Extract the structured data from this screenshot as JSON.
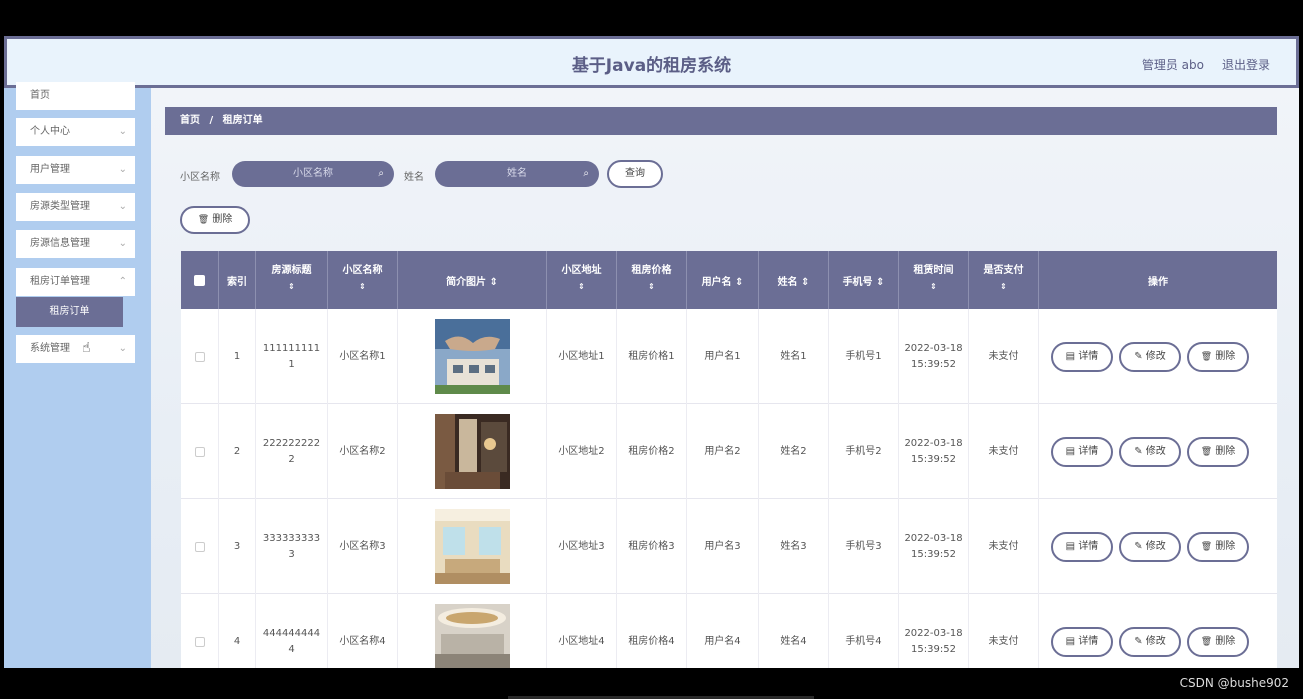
{
  "header": {
    "title": "基于Java的租房系统",
    "user": "管理员 abo",
    "logout": "退出登录"
  },
  "sidebar": {
    "items": [
      {
        "label": "首页",
        "chevron": ""
      },
      {
        "label": "个人中心",
        "chevron": "⌄"
      },
      {
        "label": "用户管理",
        "chevron": "⌄"
      },
      {
        "label": "房源类型管理",
        "chevron": "⌄"
      },
      {
        "label": "房源信息管理",
        "chevron": "⌄"
      },
      {
        "label": "租房订单管理",
        "chevron": "⌃"
      },
      {
        "label": "系统管理",
        "chevron": "⌄"
      }
    ],
    "submenu": {
      "label": "租房订单"
    }
  },
  "breadcrumb": {
    "home": "首页",
    "separator": "/",
    "current": "租房订单"
  },
  "filters": {
    "community_label": "小区名称",
    "community_placeholder": "小区名称",
    "name_label": "姓名",
    "name_placeholder": "姓名",
    "query_button": "查询",
    "delete_button": "删除"
  },
  "table": {
    "headers": [
      {
        "label": "",
        "sort": ""
      },
      {
        "label": "索引",
        "sort": ""
      },
      {
        "label": "房源标题",
        "sort": "⇕"
      },
      {
        "label": "小区名称",
        "sort": "⇕"
      },
      {
        "label": "简介图片 ⇕",
        "sort": ""
      },
      {
        "label": "小区地址",
        "sort": "⇕"
      },
      {
        "label": "租房价格",
        "sort": "⇕"
      },
      {
        "label": "用户名 ⇕",
        "sort": ""
      },
      {
        "label": "姓名 ⇕",
        "sort": ""
      },
      {
        "label": "手机号 ⇕",
        "sort": ""
      },
      {
        "label": "租赁时间",
        "sort": "⇕"
      },
      {
        "label": "是否支付",
        "sort": "⇕"
      },
      {
        "label": "操作",
        "sort": ""
      }
    ],
    "rows": [
      {
        "index": "1",
        "title": "1111111111",
        "community": "小区名称1",
        "address": "小区地址1",
        "price": "租房价格1",
        "username": "用户名1",
        "name": "姓名1",
        "phone": "手机号1",
        "time": "2022-03-18 15:39:52",
        "paid": "未支付"
      },
      {
        "index": "2",
        "title": "2222222222",
        "community": "小区名称2",
        "address": "小区地址2",
        "price": "租房价格2",
        "username": "用户名2",
        "name": "姓名2",
        "phone": "手机号2",
        "time": "2022-03-18 15:39:52",
        "paid": "未支付"
      },
      {
        "index": "3",
        "title": "3333333333",
        "community": "小区名称3",
        "address": "小区地址3",
        "price": "租房价格3",
        "username": "用户名3",
        "name": "姓名3",
        "phone": "手机号3",
        "time": "2022-03-18 15:39:52",
        "paid": "未支付"
      },
      {
        "index": "4",
        "title": "4444444444",
        "community": "小区名称4",
        "address": "小区地址4",
        "price": "租房价格4",
        "username": "用户名4",
        "name": "姓名4",
        "phone": "手机号4",
        "time": "2022-03-18 15:39:52",
        "paid": "未支付"
      }
    ],
    "actions": {
      "detail": "详情",
      "edit": "修改",
      "delete": "删除"
    }
  },
  "icons": {
    "search": "⌕",
    "trash": "🗑",
    "detail": "▤",
    "edit": "✎",
    "cursor": "☝"
  },
  "watermark": "CSDN @bushe902",
  "colors": {
    "accent": "#6b6e95",
    "sidebar": "#b0cdef",
    "header": "#e9f3fc"
  }
}
